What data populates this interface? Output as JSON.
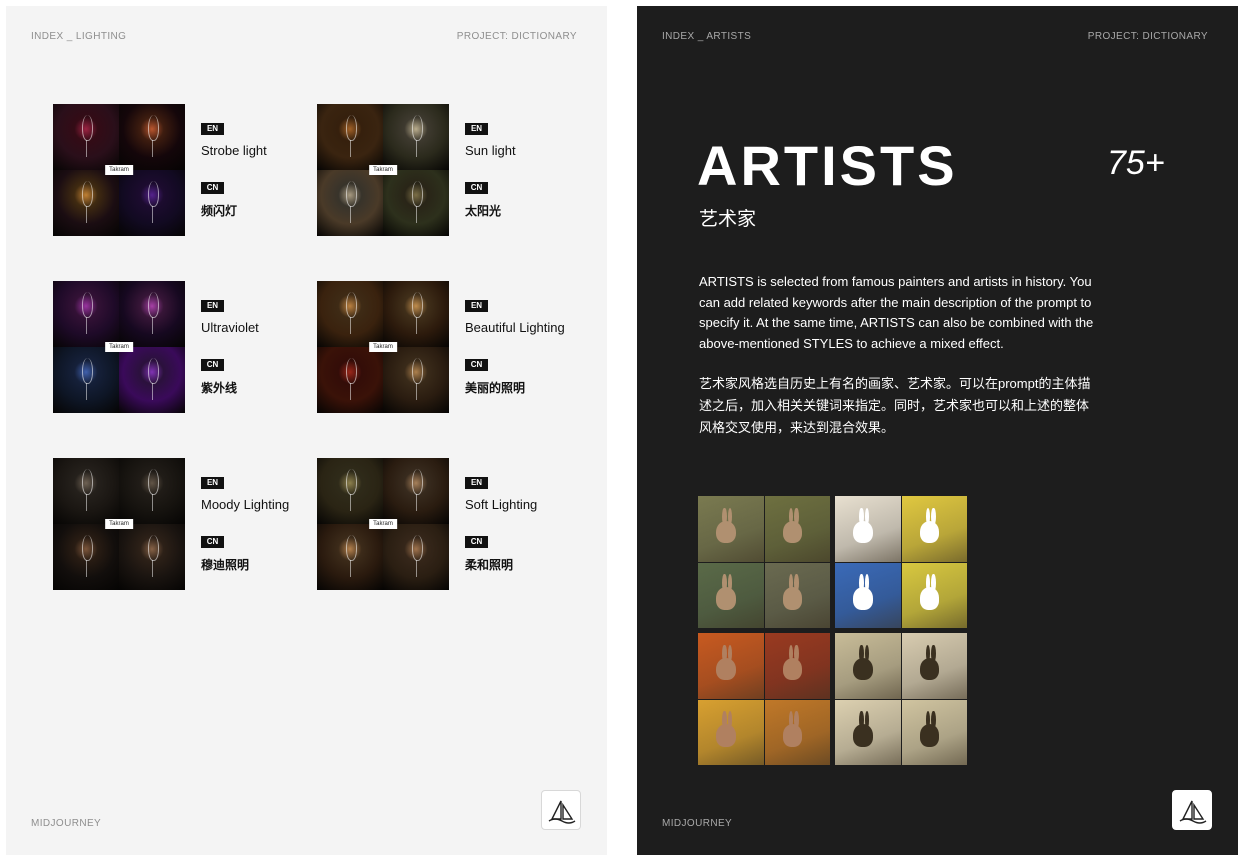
{
  "left_page": {
    "header_left": "INDEX _ LIGHTING",
    "header_right": "PROJECT: DICTIONARY",
    "footer": "MIDJOURNEY",
    "items": [
      {
        "en_badge": "EN",
        "en": "Strobe light",
        "cn_badge": "CN",
        "cn": "频闪灯",
        "tag": "Takram",
        "palette": [
          "#2a0f1a",
          "#14060a",
          "#1b0d12",
          "#120a22"
        ],
        "glow": [
          "#c22b52",
          "#e86b3a",
          "#f0a040",
          "#6a2bb0"
        ]
      },
      {
        "en_badge": "EN",
        "en": "Sun light",
        "cn_badge": "CN",
        "cn": "太阳光",
        "tag": "Takram",
        "palette": [
          "#3a2410",
          "#2b2a1c",
          "#4a3a28",
          "#2d301c"
        ],
        "glow": [
          "#c87830",
          "#e8d8b0",
          "#d0c0a0",
          "#9a8a58"
        ]
      },
      {
        "en_badge": "EN",
        "en": "Ultraviolet",
        "cn_badge": "CN",
        "cn": "紫外线",
        "tag": "Takram",
        "palette": [
          "#1e0a28",
          "#160820",
          "#0e1626",
          "#3a0a5a"
        ],
        "glow": [
          "#c040c8",
          "#d050d0",
          "#5078d8",
          "#a040e0"
        ]
      },
      {
        "en_badge": "EN",
        "en": "Beautiful Lighting",
        "cn_badge": "CN",
        "cn": "美丽的照明",
        "tag": "Takram",
        "palette": [
          "#3a220e",
          "#2c1a0c",
          "#3a1208",
          "#2a1c10"
        ],
        "glow": [
          "#e8a050",
          "#f0b060",
          "#c03020",
          "#d8a060"
        ]
      },
      {
        "en_badge": "EN",
        "en": "Moody Lighting",
        "cn_badge": "CN",
        "cn": "穆迪照明",
        "tag": "Takram",
        "palette": [
          "#1a1612",
          "#16130f",
          "#120e0c",
          "#1a1410"
        ],
        "glow": [
          "#8a7a68",
          "#7a6a58",
          "#9a6a48",
          "#a87a58"
        ]
      },
      {
        "en_badge": "EN",
        "en": "Soft Lighting",
        "cn_badge": "CN",
        "cn": "柔和照明",
        "tag": "Takram",
        "palette": [
          "#2a2414",
          "#2a1c10",
          "#2a1a0e",
          "#2a1e12"
        ],
        "glow": [
          "#b0a060",
          "#d0a070",
          "#e0a060",
          "#c89060"
        ]
      }
    ]
  },
  "right_page": {
    "header_left": "INDEX _ ARTISTS",
    "header_right": "PROJECT: DICTIONARY",
    "title": "ARTISTS",
    "count": "75+",
    "subtitle": "艺术家",
    "description_en": "ARTISTS is selected from famous painters and artists in history. You can add related keywords after the main description of the prompt to specify it. At the same time, ARTISTS can also be combined with the above-mentioned STYLES to achieve a mixed effect.",
    "description_cn": "艺术家风格选自历史上有名的画家、艺术家。可以在prompt的主体描述之后，加入相关关键词来指定。同时，艺术家也可以和上述的整体风格交叉使用，来达到混合效果。",
    "footer": "MIDJOURNEY",
    "artworks": [
      {
        "cells": [
          "#7a7a50",
          "#6e7040",
          "#5a6a48",
          "#6a6a50"
        ],
        "rabbit": "#b09070"
      },
      {
        "cells": [
          "#e8e0d0",
          "#e0c840",
          "#3a6ab8",
          "#d8c840"
        ],
        "rabbit": "#ffffff"
      },
      {
        "cells": [
          "#c85a20",
          "#9a3a20",
          "#d8a030",
          "#c07828"
        ],
        "rabbit": "#b08060"
      },
      {
        "cells": [
          "#c8bc98",
          "#d8ccb0",
          "#dcd0b0",
          "#d0c4a0"
        ],
        "rabbit": "#3a3020"
      }
    ]
  }
}
